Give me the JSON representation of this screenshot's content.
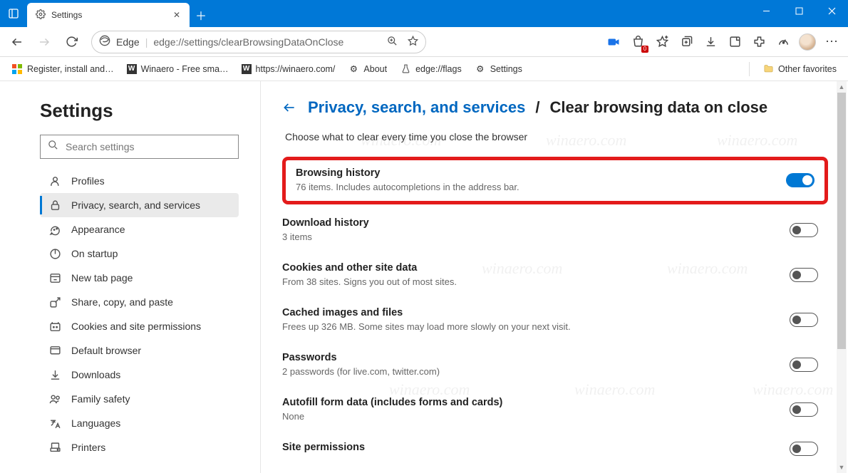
{
  "window": {
    "tab_title": "Settings",
    "browser_label": "Edge",
    "url": "edge://settings/clearBrowsingDataOnClose"
  },
  "bookmarks": {
    "b1": "Register, install and…",
    "b2": "Winaero - Free sma…",
    "b3": "https://winaero.com/",
    "b4": "About",
    "b5": "edge://flags",
    "b6": "Settings",
    "other": "Other favorites"
  },
  "sidebar": {
    "heading": "Settings",
    "search_placeholder": "Search settings",
    "items": [
      "Profiles",
      "Privacy, search, and services",
      "Appearance",
      "On startup",
      "New tab page",
      "Share, copy, and paste",
      "Cookies and site permissions",
      "Default browser",
      "Downloads",
      "Family safety",
      "Languages",
      "Printers"
    ]
  },
  "main": {
    "breadcrumb_parent": "Privacy, search, and services",
    "breadcrumb_current": "Clear browsing data on close",
    "description": "Choose what to clear every time you close the browser",
    "options": [
      {
        "title": "Browsing history",
        "sub": "76 items. Includes autocompletions in the address bar.",
        "on": true
      },
      {
        "title": "Download history",
        "sub": "3 items",
        "on": false
      },
      {
        "title": "Cookies and other site data",
        "sub": "From 38 sites. Signs you out of most sites.",
        "on": false
      },
      {
        "title": "Cached images and files",
        "sub": "Frees up 326 MB. Some sites may load more slowly on your next visit.",
        "on": false
      },
      {
        "title": "Passwords",
        "sub": "2 passwords (for live.com, twitter.com)",
        "on": false
      },
      {
        "title": "Autofill form data (includes forms and cards)",
        "sub": "None",
        "on": false
      },
      {
        "title": "Site permissions",
        "sub": "",
        "on": false
      }
    ]
  },
  "watermark": "winaero.com"
}
